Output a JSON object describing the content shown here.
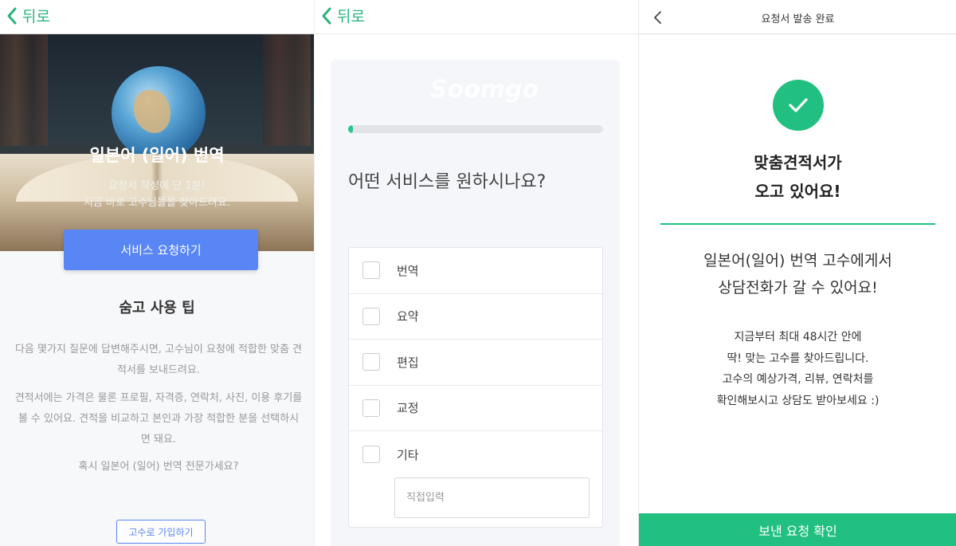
{
  "panel1": {
    "back_label": "뒤로",
    "hero_title": "일본어 (일어) 번역",
    "hero_sub_line1": "요청서 작성에 단 1분!",
    "hero_sub_line2": "지금 바로 고수님들을 찾아드려요.",
    "service_button": "서비스 요청하기",
    "tip_title": "숨고 사용 팁",
    "tip_p1": "다음 몇가지 질문에 답변해주시면, 고수님이 요청에 적합한 맞춤 견적서를 보내드려요.",
    "tip_p2": "견적서에는 가격은 물론 프로필, 자격증, 연락처, 사진, 이용 후기를 볼 수 있어요. 견적을 비교하고 본인과 가장 적합한 분을 선택하시면 돼요.",
    "tip_p3": "혹시 일본어 (일어) 번역 전문가세요?",
    "join_button": "고수로 가입하기"
  },
  "panel2": {
    "back_label": "뒤로",
    "watermark": "Soomgo",
    "progress_fraction": 0.01,
    "question": "어떤 서비스를 원하시나요?",
    "options": [
      "번역",
      "요약",
      "편집",
      "교정",
      "기타"
    ],
    "etc_placeholder": "직접입력"
  },
  "panel3": {
    "title": "요청서 발송 완료",
    "done_line1": "맞춤견적서가",
    "done_line2": "오고 있어요!",
    "msg_line1": "일본어(일어) 번역 고수에게서",
    "msg_line2": "상담전화가 갈 수 있어요!",
    "detail_line1": "지금부터 최대 48시간 안에",
    "detail_line2": "딱! 맞는 고수를 찾아드립니다.",
    "detail_line3": "고수의 예상가격, 리뷰, 연락처를",
    "detail_line4": "확인해보시고 상담도 받아보세요 :)",
    "confirm_button": "보낸 요청 확인"
  },
  "colors": {
    "green": "#21c080",
    "blue": "#5886f5",
    "back_green": "#29b57c"
  },
  "icons": [
    "chevron-left-icon",
    "checkmark-icon"
  ]
}
